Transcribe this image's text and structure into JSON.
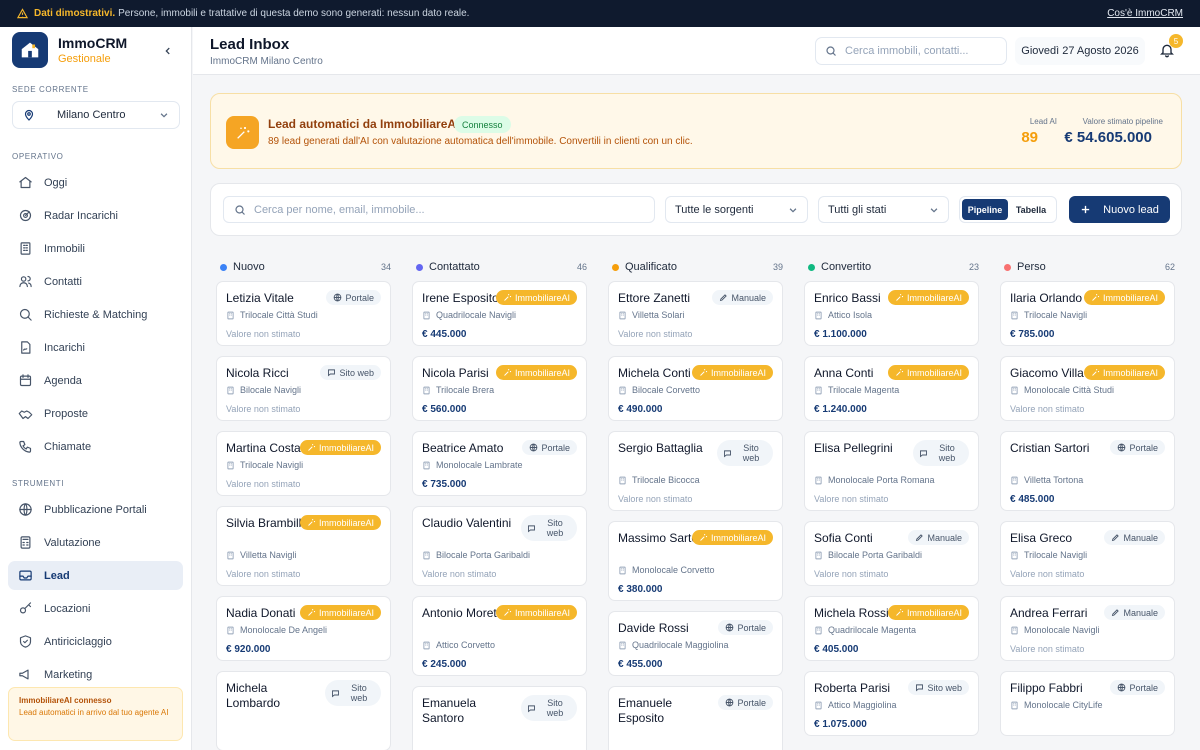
{
  "banner": {
    "bold": "Dati dimostrativi.",
    "text": "Persone, immobili e trattative di questa demo sono generati: nessun dato reale.",
    "link": "Cos'è ImmoCRM"
  },
  "brand": {
    "name": "ImmoCRM",
    "sub": "Gestionale"
  },
  "sidebar": {
    "sede_label": "Sede corrente",
    "sede_value": "Milano Centro",
    "section_operativo": "Operativo",
    "section_strumenti": "Strumenti",
    "operativo": [
      {
        "label": "Oggi",
        "icon": "home-icon"
      },
      {
        "label": "Radar Incarichi",
        "icon": "radar-icon"
      },
      {
        "label": "Immobili",
        "icon": "building-icon"
      },
      {
        "label": "Contatti",
        "icon": "users-icon"
      },
      {
        "label": "Richieste & Matching",
        "icon": "search-icon"
      },
      {
        "label": "Incarichi",
        "icon": "file-signature-icon"
      },
      {
        "label": "Agenda",
        "icon": "calendar-icon"
      },
      {
        "label": "Proposte",
        "icon": "handshake-icon"
      },
      {
        "label": "Chiamate",
        "icon": "phone-icon"
      }
    ],
    "strumenti": [
      {
        "label": "Pubblicazione Portali",
        "icon": "globe-icon"
      },
      {
        "label": "Valutazione",
        "icon": "calculator-icon"
      },
      {
        "label": "Lead",
        "icon": "inbox-icon"
      },
      {
        "label": "Locazioni",
        "icon": "key-icon"
      },
      {
        "label": "Antiriciclaggio",
        "icon": "shield-icon"
      },
      {
        "label": "Marketing",
        "icon": "megaphone-icon"
      }
    ],
    "connbox": {
      "title": "ImmobiliareAI connesso",
      "desc": "Lead automatici in arrivo dal tuo agente AI"
    }
  },
  "header": {
    "title": "Lead Inbox",
    "subtitle": "ImmoCRM Milano Centro",
    "search_placeholder": "Cerca immobili, contatti...",
    "date": "Giovedì 27 Agosto 2026",
    "notifications": "5"
  },
  "ai_card": {
    "title": "Lead automatici da ImmobiliareAI",
    "status": "Connesso",
    "desc": "89 lead generati dall'AI con valutazione automatica dell'immobile. Convertili in clienti con un clic.",
    "lead_label": "Lead AI",
    "lead_value": "89",
    "pipeline_label": "Valore stimato pipeline",
    "pipeline_value": "€ 54.605.000"
  },
  "filters": {
    "search_placeholder": "Cerca per nome, email, immobile...",
    "source": "Tutte le sorgenti",
    "status": "Tutti gli stati",
    "view_pipeline": "Pipeline",
    "view_table": "Tabella",
    "new_lead": "Nuovo lead"
  },
  "colors": {
    "nuovo": "#3b82f6",
    "contattato": "#6366f1",
    "qualificato": "#f59e0b",
    "convertito": "#10b981",
    "perso": "#f87171",
    "primary": "#163a74",
    "ai": "#f5b72b"
  },
  "columns": [
    {
      "name": "Nuovo",
      "count": "34",
      "cards": [
        {
          "name": "Letizia Vitale",
          "source": "Portale",
          "property": "Trilocale Città Studi",
          "value": "Valore non stimato"
        },
        {
          "name": "Nicola Ricci",
          "source": "Sito web",
          "property": "Bilocale Navigli",
          "value": "Valore non stimato"
        },
        {
          "name": "Martina Costa",
          "source": "ImmobiliareAI",
          "property": "Trilocale Navigli",
          "value": "Valore non stimato"
        },
        {
          "name": "Silvia Brambilla",
          "source": "ImmobiliareAI",
          "property": "Villetta Navigli",
          "value": "Valore non stimato"
        },
        {
          "name": "Nadia Donati",
          "source": "ImmobiliareAI",
          "property": "Monolocale De Angeli",
          "value": "€ 920.000"
        },
        {
          "name": "Michela Lombardo",
          "source": "Sito web",
          "property": "",
          "value": ""
        }
      ]
    },
    {
      "name": "Contattato",
      "count": "46",
      "cards": [
        {
          "name": "Irene Esposito",
          "source": "ImmobiliareAI",
          "property": "Quadrilocale Navigli",
          "value": "€ 445.000"
        },
        {
          "name": "Nicola Parisi",
          "source": "ImmobiliareAI",
          "property": "Trilocale Brera",
          "value": "€ 560.000"
        },
        {
          "name": "Beatrice Amato",
          "source": "Portale",
          "property": "Monolocale Lambrate",
          "value": "€ 735.000"
        },
        {
          "name": "Claudio Valentini",
          "source": "Sito web",
          "property": "Bilocale Porta Garibaldi",
          "value": "Valore non stimato"
        },
        {
          "name": "Antonio Moretti",
          "source": "ImmobiliareAI",
          "property": "Attico Corvetto",
          "value": "€ 245.000"
        },
        {
          "name": "Emanuela Santoro",
          "source": "Sito web",
          "property": "",
          "value": ""
        }
      ]
    },
    {
      "name": "Qualificato",
      "count": "39",
      "cards": [
        {
          "name": "Ettore Zanetti",
          "source": "Manuale",
          "property": "Villetta Solari",
          "value": "Valore non stimato"
        },
        {
          "name": "Michela Conti",
          "source": "ImmobiliareAI",
          "property": "Bilocale Corvetto",
          "value": "€ 490.000"
        },
        {
          "name": "Sergio Battaglia",
          "source": "Sito web",
          "property": "Trilocale Bicocca",
          "value": "Valore non stimato"
        },
        {
          "name": "Massimo Sartori",
          "source": "ImmobiliareAI",
          "property": "Monolocale Corvetto",
          "value": "€ 380.000"
        },
        {
          "name": "Davide Rossi",
          "source": "Portale",
          "property": "Quadrilocale Maggiolina",
          "value": "€ 455.000"
        },
        {
          "name": "Emanuele Esposito",
          "source": "Portale",
          "property": "",
          "value": ""
        }
      ]
    },
    {
      "name": "Convertito",
      "count": "23",
      "cards": [
        {
          "name": "Enrico Bassi",
          "source": "ImmobiliareAI",
          "property": "Attico Isola",
          "value": "€ 1.100.000"
        },
        {
          "name": "Anna Conti",
          "source": "ImmobiliareAI",
          "property": "Trilocale Magenta",
          "value": "€ 1.240.000"
        },
        {
          "name": "Elisa Pellegrini",
          "source": "Sito web",
          "property": "Monolocale Porta Romana",
          "value": "Valore non stimato"
        },
        {
          "name": "Sofia Conti",
          "source": "Manuale",
          "property": "Bilocale Porta Garibaldi",
          "value": "Valore non stimato"
        },
        {
          "name": "Michela Rossi",
          "source": "ImmobiliareAI",
          "property": "Quadrilocale Magenta",
          "value": "€ 405.000"
        },
        {
          "name": "Roberta Parisi",
          "source": "Sito web",
          "property": "Attico Maggiolina",
          "value": "€ 1.075.000"
        }
      ]
    },
    {
      "name": "Perso",
      "count": "62",
      "cards": [
        {
          "name": "Ilaria Orlando",
          "source": "ImmobiliareAI",
          "property": "Trilocale Navigli",
          "value": "€ 785.000"
        },
        {
          "name": "Giacomo Villa",
          "source": "ImmobiliareAI",
          "property": "Monolocale Città Studi",
          "value": "Valore non stimato"
        },
        {
          "name": "Cristian Sartori",
          "source": "Portale",
          "property": "Villetta Tortona",
          "value": "€ 485.000"
        },
        {
          "name": "Elisa Greco",
          "source": "Manuale",
          "property": "Trilocale Navigli",
          "value": "Valore non stimato"
        },
        {
          "name": "Andrea Ferrari",
          "source": "Manuale",
          "property": "Monolocale Navigli",
          "value": "Valore non stimato"
        },
        {
          "name": "Filippo Fabbri",
          "source": "Portale",
          "property": "Monolocale CityLife",
          "value": ""
        }
      ]
    }
  ]
}
